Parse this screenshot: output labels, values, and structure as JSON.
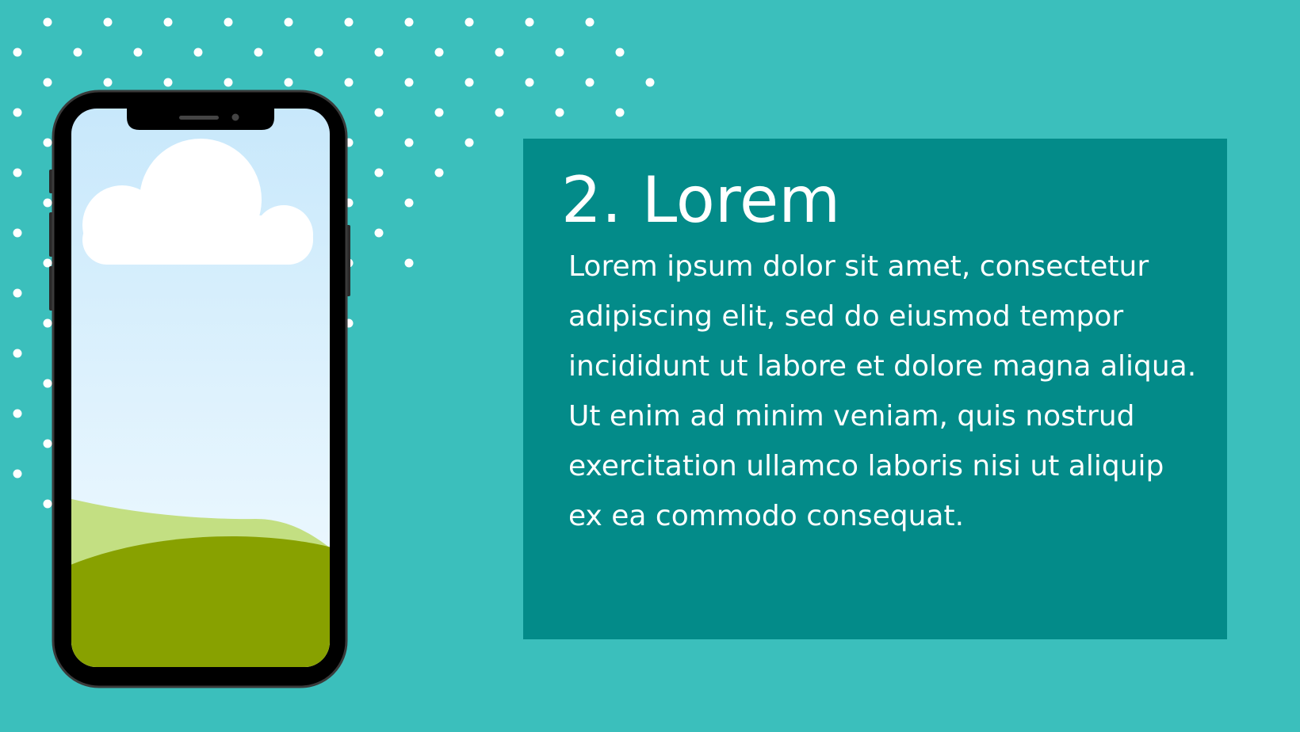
{
  "slide": {
    "title": "2. Lorem",
    "body": "Lorem ipsum dolor sit amet, consectetur adipiscing elit, sed do eiusmod tempor incididunt ut labore et dolore magna aliqua. Ut enim ad minim veniam, quis nostrud exercitation ullamco laboris nisi ut aliquip ex ea commodo consequat."
  },
  "colors": {
    "background": "#3bbfbc",
    "card": "#038b89",
    "text": "#ffffff",
    "dot": "#ffffff",
    "phone_body": "#000000",
    "phone_frame": "#3a3a3a",
    "sky_top": "#c8e8fb",
    "sky_bottom": "#f3fbff",
    "cloud": "#ffffff",
    "hill_light": "#c3df82",
    "hill_dark": "#88a100"
  },
  "icons": {
    "decoration": "dot-pattern",
    "illustration": "smartphone-icon",
    "scene": "cloud-icon"
  }
}
